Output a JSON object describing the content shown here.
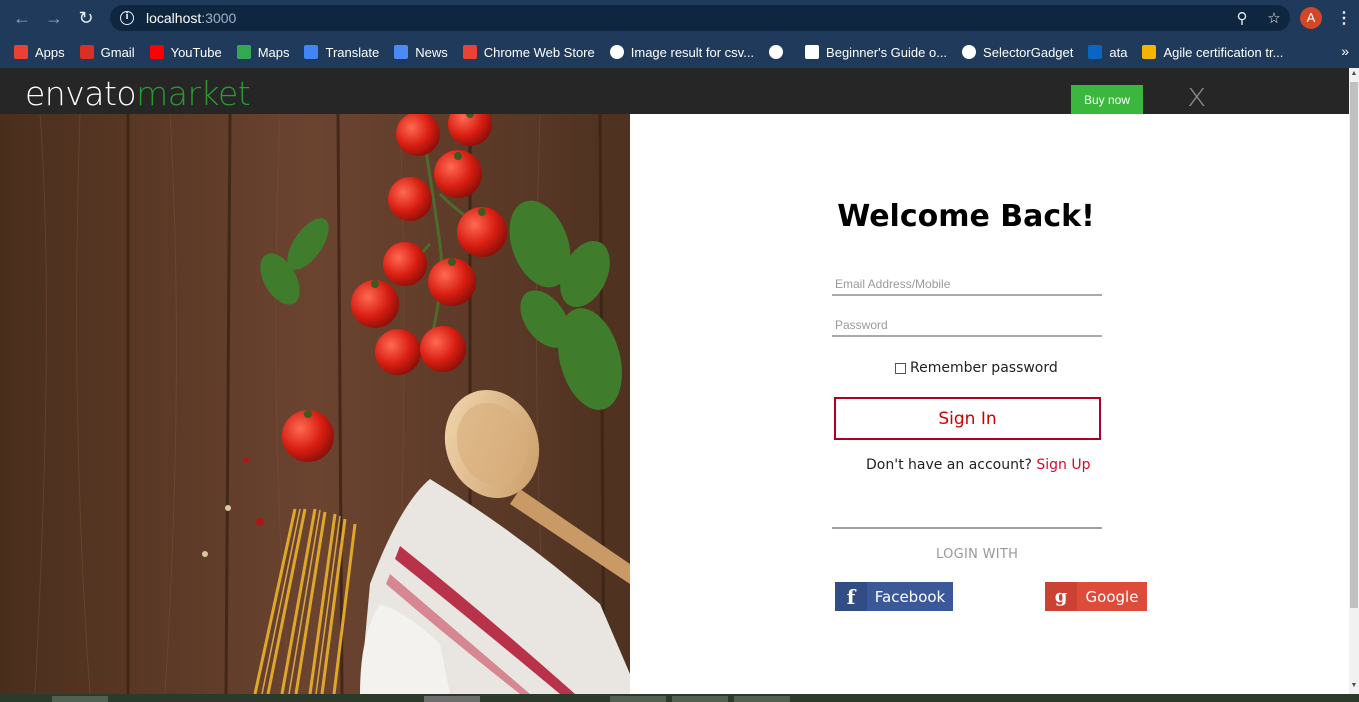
{
  "browser": {
    "url_host": "localhost",
    "url_port": ":3000",
    "avatar_letter": "A",
    "bookmarks": [
      {
        "label": "Apps",
        "icon": "apps-grid-icon",
        "color": "#e94235"
      },
      {
        "label": "Gmail",
        "icon": "gmail-icon",
        "color": "#d93025"
      },
      {
        "label": "YouTube",
        "icon": "youtube-icon",
        "color": "#ff0000"
      },
      {
        "label": "Maps",
        "icon": "maps-icon",
        "color": "#34a853"
      },
      {
        "label": "Translate",
        "icon": "translate-icon",
        "color": "#4285f4"
      },
      {
        "label": "News",
        "icon": "news-icon",
        "color": "#4c8bf5"
      },
      {
        "label": "Chrome Web Store",
        "icon": "web-store-icon",
        "color": "#ea4335"
      },
      {
        "label": "Image result for csv...",
        "icon": "google-icon",
        "color": "#ffffff"
      },
      {
        "label": "",
        "icon": "globe-icon",
        "color": "#ffffff"
      },
      {
        "label": "Beginner's Guide o...",
        "icon": "page-icon",
        "color": "#ffffff"
      },
      {
        "label": "SelectorGadget",
        "icon": "globe-icon",
        "color": "#ffffff"
      },
      {
        "label": "ata",
        "icon": "linkedin-icon",
        "color": "#0a66c2"
      },
      {
        "label": "Agile certification tr...",
        "icon": "bookmark-icon",
        "color": "#f4b400"
      }
    ]
  },
  "envato": {
    "logo_part1": "envato",
    "logo_part2": "market",
    "buy_now": "Buy now",
    "remove": "x Remove",
    "brand_green": "#2d9a31",
    "button_green": "#3ab73c"
  },
  "login": {
    "title": "Welcome Back!",
    "email_placeholder": "Email Address/Mobile",
    "password_placeholder": "Password",
    "remember_label": "Remember password",
    "signin_label": "Sign In",
    "no_account_text": "Don't have an account? ",
    "signup_label": "Sign Up",
    "login_with": "LOGIN WITH",
    "facebook_label": "Facebook",
    "google_label": "Google",
    "accent_red": "#c00000",
    "facebook_color": "#3b5998",
    "google_color": "#dd4b39"
  }
}
